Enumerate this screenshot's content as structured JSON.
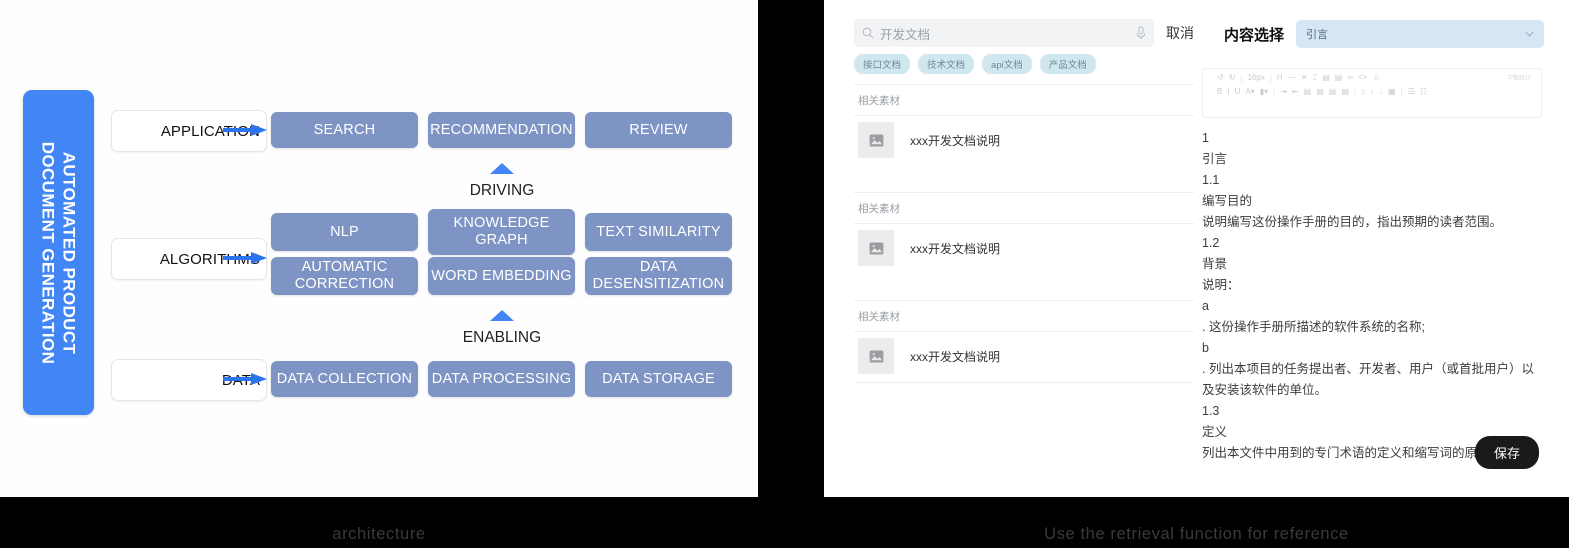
{
  "captions": {
    "left": "architecture",
    "right": "Use the retrieval function for reference"
  },
  "colors": {
    "accent_blue": "#4285f4",
    "cell_blue": "#7e94c4",
    "tag_bg": "#cfe8f0",
    "select_bg": "#d7e6f5",
    "save_bg": "#1a1a1a"
  },
  "architecture": {
    "vertical_label_line1": "AUTOMATED PRODUCT",
    "vertical_label_line2": "DOCUMENT GENERATION",
    "tiers": [
      {
        "label": "APPLICATION",
        "rows": [
          [
            "SEARCH",
            "RECOMMENDATION",
            "REVIEW"
          ]
        ]
      },
      {
        "label": "ALGORITHMS",
        "rows": [
          [
            "NLP",
            "KNOWLEDGE GRAPH",
            "TEXT SIMILARITY"
          ],
          [
            "AUTOMATIC CORRECTION",
            "WORD EMBEDDING",
            "DATA DESENSITIZATION"
          ]
        ]
      },
      {
        "label": "DATA",
        "rows": [
          [
            "DATA COLLECTION",
            "DATA PROCESSING",
            "DATA STORAGE"
          ]
        ]
      }
    ],
    "connectors": [
      {
        "text": "DRIVING"
      },
      {
        "text": "ENABLING"
      }
    ]
  },
  "app": {
    "search": {
      "value": "开发文档",
      "search_icon": "search-icon",
      "mic_icon": "microphone-icon",
      "cancel_label": "取消"
    },
    "tags": [
      "接口文档",
      "技术文档",
      "api文档",
      "产品文档"
    ],
    "groups": [
      {
        "title": "相关素材",
        "items": [
          {
            "title": "xxx开发文档说明",
            "thumb_icon": "image-placeholder-icon"
          }
        ]
      },
      {
        "title": "相关素材",
        "items": [
          {
            "title": "xxx开发文档说明",
            "thumb_icon": "image-placeholder-icon"
          }
        ]
      },
      {
        "title": "相关素材",
        "items": [
          {
            "title": "xxx开发文档说明",
            "thumb_icon": "image-placeholder-icon"
          }
        ]
      }
    ],
    "content_panel": {
      "title": "内容选择",
      "select_value": "引言",
      "chevron_icon": "chevron-down-icon"
    },
    "editor_toolbar": {
      "font_size": "16px",
      "row1": [
        "undo-icon",
        "redo-icon",
        "|",
        "16px",
        "▾",
        "|",
        "heading-icon",
        "minus-icon",
        "clear-format-icon",
        "format-paint-icon",
        "copy-icon",
        "paste-icon",
        "link-icon",
        "code-icon",
        "emoji-icon"
      ],
      "row2": [
        "B",
        "I",
        "U",
        "A",
        "▾",
        "bg-color-icon",
        "▾",
        "|",
        "indent-icon",
        "outdent-icon",
        "align-left-icon",
        "align-center-icon",
        "align-right-icon",
        "align-justify-icon",
        "|",
        "line-height-icon",
        "sup-icon",
        "sub-icon",
        "table-icon",
        "|",
        "ul-icon",
        "ol-icon"
      ],
      "word_count": "字数统计"
    },
    "document_lines": [
      "1",
      "引言",
      "1.1",
      "编写目的",
      "说明编写这份操作手册的目的，指出预期的读者范围。",
      "1.2",
      "背景",
      "说明：",
      "a",
      ". 这份操作手册所描述的软件系统的名称;",
      "b",
      ". 列出本项目的任务提出者、开发者、用户（或首批用户）以及安装该软件的单位。",
      "1.3",
      "定义",
      "列出本文件中用到的专门术语的定义和缩写词的原词组。"
    ],
    "save_label": "保存"
  }
}
